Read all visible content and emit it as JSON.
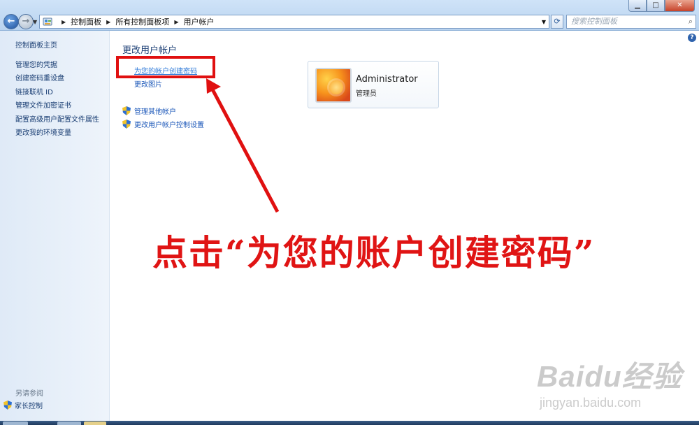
{
  "window": {
    "controls": {
      "minimize": "▁",
      "maximize": "□",
      "close": "✕"
    }
  },
  "address_bar": {
    "crumbs": [
      "控制面板",
      "所有控制面板项",
      "用户帐户"
    ],
    "search_placeholder": "搜索控制面板"
  },
  "nav": {
    "home": "控制面板主页",
    "items": [
      "管理您的凭据",
      "创建密码重设盘",
      "链接联机 ID",
      "管理文件加密证书",
      "配置高级用户配置文件属性",
      "更改我的环境变量"
    ],
    "see_also_label": "另请参阅",
    "see_also_items": [
      "家长控制"
    ]
  },
  "main": {
    "title": "更改用户帐户",
    "tasks": [
      "为您的帐户创建密码",
      "更改图片"
    ],
    "shield_tasks": [
      "管理其他帐户",
      "更改用户帐户控制设置"
    ],
    "user": {
      "name": "Administrator",
      "role": "管理员"
    }
  },
  "annotation": {
    "caption": "点击“为您的账户创建密码”",
    "color": "#e01414"
  },
  "watermark": {
    "line1": "Baidu经验",
    "line2": "jingyan.baidu.com"
  },
  "icons": {
    "back": "left-arrow-icon",
    "forward": "right-arrow-icon",
    "refresh": "refresh-icon",
    "search": "search-icon",
    "help": "help-icon",
    "shield": "uac-shield-icon"
  }
}
